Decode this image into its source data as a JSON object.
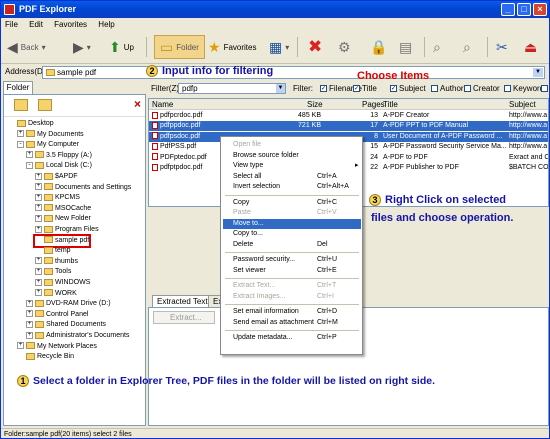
{
  "window": {
    "title": "PDF Explorer",
    "min": "_",
    "max": "□",
    "close": "×"
  },
  "menu": [
    "File",
    "Edit",
    "Favorites",
    "Help"
  ],
  "toolbar": {
    "back": "Back",
    "forward": "",
    "up": "Up",
    "folder": "Folder",
    "favorites": "Favorites"
  },
  "address": {
    "label": "Address(D):",
    "value": "sample pdf"
  },
  "folder_tab": "Folder",
  "tree": [
    {
      "label": "Desktop",
      "level": 0,
      "pm": ""
    },
    {
      "label": "My Documents",
      "level": 1,
      "pm": "+"
    },
    {
      "label": "My Computer",
      "level": 1,
      "pm": "-"
    },
    {
      "label": "3.5 Floppy (A:)",
      "level": 2,
      "pm": "+"
    },
    {
      "label": "Local Disk (C:)",
      "level": 2,
      "pm": "-"
    },
    {
      "label": "$APDF",
      "level": 3,
      "pm": "+"
    },
    {
      "label": "Documents and Settings",
      "level": 3,
      "pm": "+"
    },
    {
      "label": "KPCMS",
      "level": 3,
      "pm": "+"
    },
    {
      "label": "MSOCache",
      "level": 3,
      "pm": "+"
    },
    {
      "label": "New Folder",
      "level": 3,
      "pm": "+"
    },
    {
      "label": "Program Files",
      "level": 3,
      "pm": "+"
    },
    {
      "label": "sample pdf",
      "level": 3,
      "pm": "",
      "highlight": true
    },
    {
      "label": "temp",
      "level": 3,
      "pm": ""
    },
    {
      "label": "thumbs",
      "level": 3,
      "pm": "+"
    },
    {
      "label": "Tools",
      "level": 3,
      "pm": "+"
    },
    {
      "label": "WINDOWS",
      "level": 3,
      "pm": "+"
    },
    {
      "label": "WORK",
      "level": 3,
      "pm": "+"
    },
    {
      "label": "DVD-RAM Drive (D:)",
      "level": 2,
      "pm": "+"
    },
    {
      "label": "Control Panel",
      "level": 2,
      "pm": "+"
    },
    {
      "label": "Shared Documents",
      "level": 2,
      "pm": "+"
    },
    {
      "label": "Administrator's Documents",
      "level": 2,
      "pm": "+"
    },
    {
      "label": "My Network Places",
      "level": 1,
      "pm": "+"
    },
    {
      "label": "Recycle Bin",
      "level": 1,
      "pm": ""
    }
  ],
  "filter": {
    "label": "Filter(Z):",
    "value": "pdfp",
    "label2": "Filter:",
    "checks": [
      {
        "label": "Filename",
        "checked": true
      },
      {
        "label": "Title",
        "checked": true
      },
      {
        "label": "Subject",
        "checked": true
      },
      {
        "label": "Author",
        "checked": false
      },
      {
        "label": "Creator",
        "checked": false
      },
      {
        "label": "Keywords",
        "checked": false
      },
      {
        "label": "Pro",
        "checked": false
      }
    ]
  },
  "columns": [
    "Name",
    "Size",
    "Pages",
    "Title",
    "Subject"
  ],
  "files": [
    {
      "name": "pdfpcrdoc.pdf",
      "size": "485 KB",
      "pages": "13",
      "title": "A-PDF Creator",
      "subject": "http://www.a",
      "selected": false
    },
    {
      "name": "pdfppdoc.pdf",
      "size": "721 KB",
      "pages": "17",
      "title": "A-PDF PPT to PDF Manual",
      "subject": "http://www.a",
      "selected": true
    },
    {
      "name": "pdfpsdoc.pdf",
      "size": "",
      "pages": "8",
      "title": "User Document of A-PDF Password ...",
      "subject": "http://www.a",
      "selected": true
    },
    {
      "name": "PdfPSS.pdf",
      "size": "",
      "pages": "15",
      "title": "A-PDF Password Security Service Ma...",
      "subject": "http://www.a",
      "selected": false
    },
    {
      "name": "PDFptedoc.pdf",
      "size": "",
      "pages": "24",
      "title": "A-PDF to PDF",
      "subject": "Exract and C",
      "selected": false
    },
    {
      "name": "pdfptpdoc.pdf",
      "size": "",
      "pages": "22",
      "title": "A-PDF Publisher to PDF",
      "subject": "$BATCH COM",
      "selected": false
    }
  ],
  "bottom_tabs": [
    "Extracted Text",
    "Extr"
  ],
  "bottom_extract": "Extract...",
  "context_menu": [
    {
      "label": "Open file",
      "shortcut": "",
      "disabled": true
    },
    {
      "label": "Browse source folder",
      "shortcut": "",
      "disabled": false
    },
    {
      "label": "View type",
      "shortcut": "",
      "disabled": false,
      "submenu": true
    },
    {
      "label": "Select all",
      "shortcut": "Ctrl+A",
      "disabled": false
    },
    {
      "label": "Invert selection",
      "shortcut": "Ctrl+Alt+A",
      "disabled": false
    },
    {
      "sep": true
    },
    {
      "label": "Copy",
      "shortcut": "Ctrl+C",
      "disabled": false
    },
    {
      "label": "Paste",
      "shortcut": "Ctrl+V",
      "disabled": true
    },
    {
      "label": "Move to...",
      "shortcut": "",
      "disabled": false,
      "highlight": true
    },
    {
      "label": "Copy to...",
      "shortcut": "",
      "disabled": false
    },
    {
      "label": "Delete",
      "shortcut": "Del",
      "disabled": false
    },
    {
      "sep": true
    },
    {
      "label": "Password security...",
      "shortcut": "Ctrl+U",
      "disabled": false
    },
    {
      "label": "Set viewer",
      "shortcut": "Ctrl+E",
      "disabled": false
    },
    {
      "sep": true
    },
    {
      "label": "Extract Text...",
      "shortcut": "Ctrl+T",
      "disabled": true
    },
    {
      "label": "Extract Images...",
      "shortcut": "Ctrl+I",
      "disabled": true
    },
    {
      "sep": true
    },
    {
      "label": "Set email information",
      "shortcut": "Ctrl+D",
      "disabled": false
    },
    {
      "label": "Send email as attachment",
      "shortcut": "Ctrl+M",
      "disabled": false
    },
    {
      "sep": true
    },
    {
      "label": "Update metadata...",
      "shortcut": "Ctrl+P",
      "disabled": false
    }
  ],
  "annotations": {
    "a1_num": "1",
    "a1": "Select a folder in Explorer Tree, PDF files in the folder will be listed on right side.",
    "a2_num": "2",
    "a2": "Input info for filtering",
    "a3": "Choose Items",
    "a4_num": "3",
    "a4_line1": "Right Click on selected",
    "a4_line2": "files and choose operation."
  },
  "status": "Folder:sample pdf(20 items) select 2 files"
}
